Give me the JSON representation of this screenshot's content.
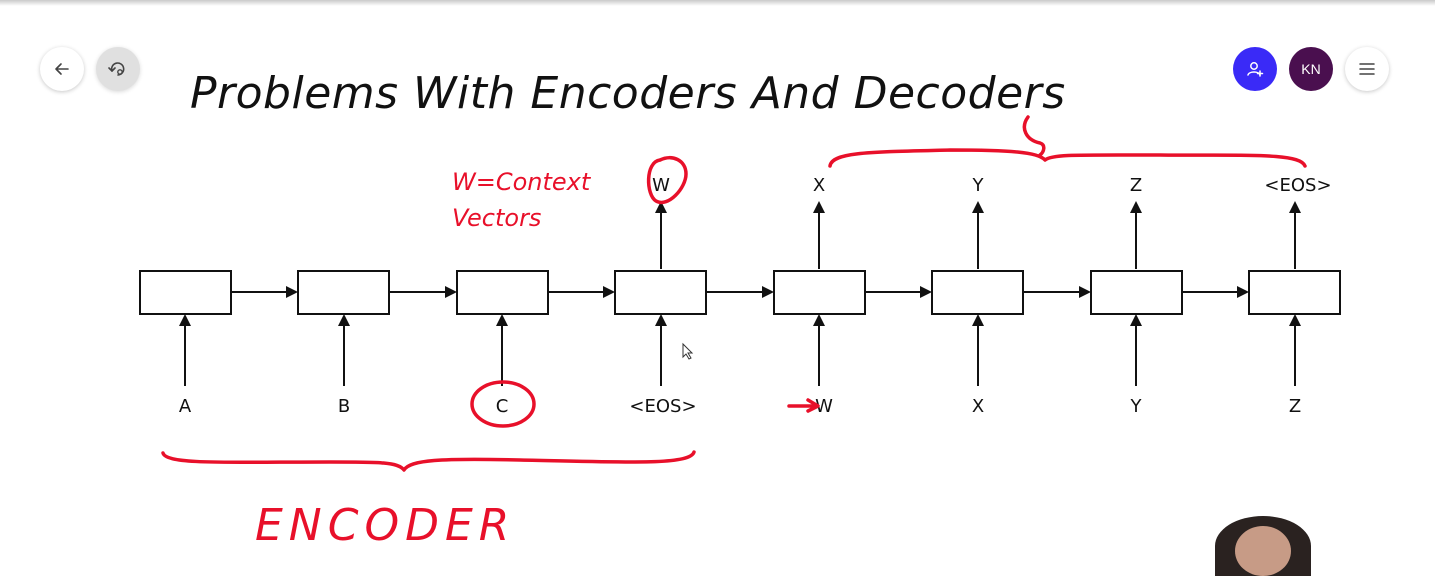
{
  "toolbar": {
    "back_icon": "arrow-left-icon",
    "redo_icon": "redo-icon",
    "share_icon": "person-add-icon",
    "avatar_initials": "KN",
    "menu_icon": "hamburger-menu-icon",
    "share_color": "#3a2af7",
    "avatar_color": "#4a0f4f"
  },
  "slide": {
    "title": "Problems With Encoders And Decoders",
    "annotation_context_line1": "W=Context",
    "annotation_context_line2": "Vectors",
    "annotation_encoder": "ENCODER",
    "annotation_color": "#e8102a",
    "diagram": {
      "inputs": [
        "A",
        "B",
        "C",
        "<EOS>",
        "W",
        "X",
        "Y",
        "Z"
      ],
      "outputs": [
        "",
        "",
        "",
        "W",
        "X",
        "Y",
        "Z",
        "<EOS>"
      ]
    }
  }
}
